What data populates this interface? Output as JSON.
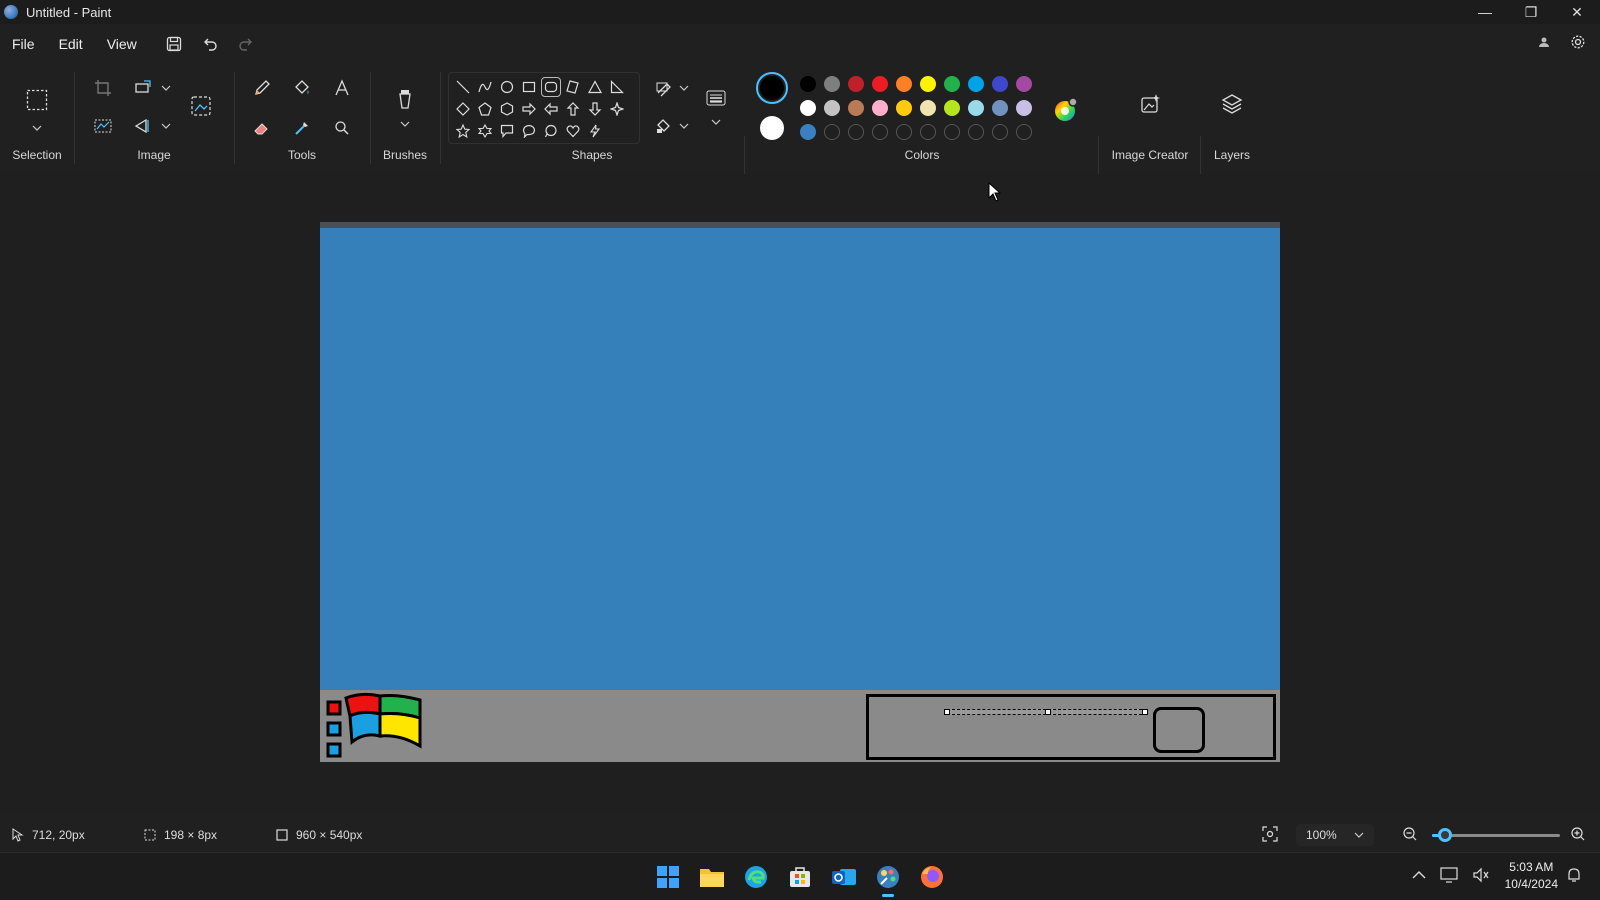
{
  "window": {
    "title": "Untitled - Paint",
    "controls": {
      "minimize": "—",
      "maximize": "❐",
      "close": "✕"
    }
  },
  "menu": {
    "items": [
      "File",
      "Edit",
      "View"
    ]
  },
  "ribbon": {
    "groups": {
      "selection": "Selection",
      "image": "Image",
      "tools": "Tools",
      "brushes": "Brushes",
      "shapes": "Shapes",
      "colors": "Colors",
      "image_creator": "Image Creator",
      "layers": "Layers"
    },
    "colors": {
      "primary": "#000000",
      "secondary": "#ffffff",
      "row1": [
        "#000000",
        "#7f7f7f",
        "#c0202a",
        "#ec1c24",
        "#ff7f27",
        "#fff200",
        "#22b14c",
        "#00a2e8",
        "#3f48cc",
        "#a349a4"
      ],
      "row2": [
        "#ffffff",
        "#c3c3c3",
        "#b97a57",
        "#ffaec9",
        "#ffc90e",
        "#efe4b0",
        "#b5e61d",
        "#99d9ea",
        "#7092be",
        "#c8bfe7"
      ],
      "row3": [
        "#3a80c0",
        "",
        "",
        "",
        "",
        "",
        "",
        "",
        "",
        ""
      ]
    }
  },
  "status": {
    "cursor_pos": "712, 20px",
    "selection_size": "198 × 8px",
    "canvas_size": "960 × 540px",
    "zoom": "100%",
    "zoom_level_fraction": 0.1
  },
  "taskbar": {
    "time": "5:03 AM",
    "date": "10/4/2024"
  },
  "canvas_drawing": {
    "sky_color": "#3580bb",
    "bar_color": "#8a8a8a"
  }
}
